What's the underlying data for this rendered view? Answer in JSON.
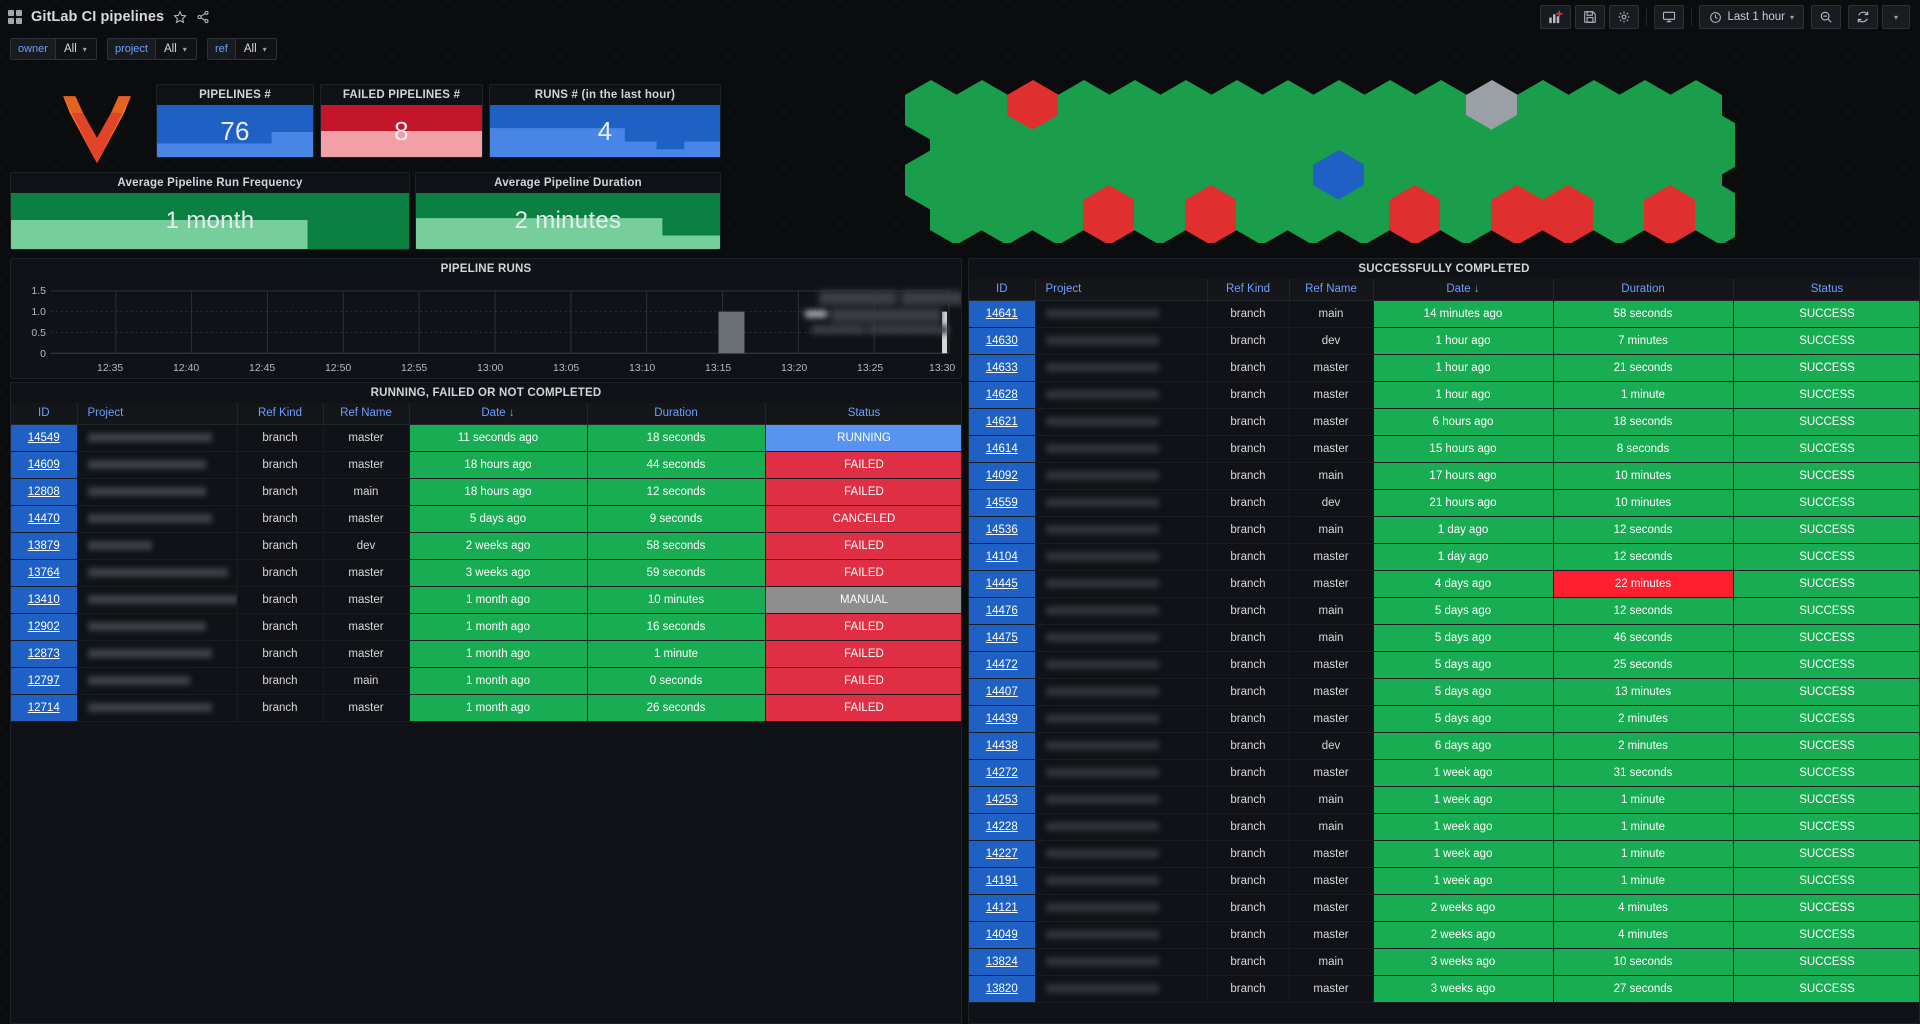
{
  "header": {
    "title": "GitLab CI pipelines",
    "grid_icon": "dashboard-grid-icon",
    "star_icon": "star-icon",
    "share_icon": "share-icon",
    "toolbar": {
      "add_panel_label": "add-panel-icon",
      "save_label": "save-icon",
      "settings_label": "gear-icon",
      "tv_label": "tv-mode-icon",
      "time_range": "Last 1 hour",
      "clock_icon": "clock-icon",
      "zoom_out_icon": "zoom-out-icon",
      "refresh_icon": "refresh-icon",
      "refresh_caret": "chevron-down-icon",
      "time_caret": "chevron-down-icon"
    }
  },
  "variables": [
    {
      "label": "owner",
      "value": "All"
    },
    {
      "label": "project",
      "value": "All"
    },
    {
      "label": "ref",
      "value": "All"
    }
  ],
  "stats": [
    {
      "title": "PIPELINES #",
      "value": "76",
      "color": "#1f60c4"
    },
    {
      "title": "FAILED PIPELINES #",
      "value": "8",
      "color": "#c4162a"
    },
    {
      "title": "RUNS # (in the last hour)",
      "value": "4",
      "color": "#1f60c4"
    },
    {
      "title": "Average Pipeline Run Frequency",
      "value": "1 month",
      "color": "#0a8041"
    },
    {
      "title": "Average Pipeline Duration",
      "value": "2 minutes",
      "color": "#0a8041"
    }
  ],
  "timeseries": {
    "title": "PIPELINE RUNS"
  },
  "chart_data": {
    "type": "bar",
    "title": "PIPELINE RUNS",
    "xlabel": "",
    "ylabel": "",
    "ylim": [
      0,
      1.5
    ],
    "ytick_labels": [
      "1.5",
      "1.0",
      "0.5",
      "0"
    ],
    "yticks": [
      1.5,
      1.0,
      0.5,
      0
    ],
    "x_tick_labels": [
      "12:35",
      "12:40",
      "12:45",
      "12:50",
      "12:55",
      "13:00",
      "13:05",
      "13:10",
      "13:15",
      "13:20",
      "13:25",
      "13:30"
    ],
    "grid": true,
    "legend_position": "right",
    "series": [
      {
        "name": "pipeline runs",
        "x": [
          "12:35",
          "12:40",
          "12:45",
          "12:50",
          "12:55",
          "13:00",
          "13:05",
          "13:10",
          "13:15",
          "13:16",
          "13:20",
          "13:25",
          "13:30"
        ],
        "values": [
          0,
          0,
          0,
          0,
          0,
          0,
          0,
          0,
          1,
          1,
          0,
          0,
          1
        ]
      }
    ]
  },
  "honeycomb": {
    "name": "pipeline-status-honeycomb",
    "rows": [
      [
        "green",
        "green",
        "red",
        "green",
        "green",
        "green",
        "green",
        "green",
        "green",
        "green",
        "green",
        "grey",
        "green",
        "green",
        "green",
        "green"
      ],
      [
        "green",
        "green",
        "green",
        "green",
        "green",
        "green",
        "green",
        "green",
        "green",
        "green",
        "green",
        "green",
        "green",
        "green",
        "green"
      ],
      [
        "green",
        "green",
        "green",
        "green",
        "green",
        "green",
        "green",
        "green",
        "blue",
        "green",
        "green",
        "green",
        "green",
        "green",
        "green",
        "green"
      ],
      [
        "green",
        "green",
        "green",
        "red",
        "green",
        "red",
        "green",
        "green",
        "green",
        "red",
        "green",
        "red",
        "red",
        "green",
        "red",
        "green"
      ]
    ]
  },
  "left_table": {
    "title": "RUNNING, FAILED OR NOT COMPLETED",
    "columns": [
      "ID",
      "Project",
      "Ref Kind",
      "Ref Name",
      "Date ↓",
      "Duration",
      "Status"
    ],
    "rows": [
      {
        "id": "14549",
        "project": "infra/k8s/nginx-ingress",
        "ref_kind": "branch",
        "ref_name": "master",
        "date": "11 seconds ago",
        "duration": "18 seconds",
        "status": "RUNNING",
        "status_color": "blue",
        "date_color": "green",
        "duration_color": "green"
      },
      {
        "id": "14609",
        "project": "infra/terraform/packer",
        "ref_kind": "branch",
        "ref_name": "master",
        "date": "18 hours ago",
        "duration": "44 seconds",
        "status": "FAILED",
        "status_color": "red",
        "date_color": "green",
        "duration_color": "green"
      },
      {
        "id": "12808",
        "project": "infra/terraform/harbor",
        "ref_kind": "branch",
        "ref_name": "main",
        "date": "18 hours ago",
        "duration": "12 seconds",
        "status": "FAILED",
        "status_color": "red",
        "date_color": "green",
        "duration_color": "green"
      },
      {
        "id": "14470",
        "project": "infra/terraform/backend",
        "ref_kind": "branch",
        "ref_name": "master",
        "date": "5 days ago",
        "duration": "9 seconds",
        "status": "CANCELED",
        "status_color": "red",
        "date_color": "green",
        "duration_color": "green"
      },
      {
        "id": "13879",
        "project": "backend/auth",
        "ref_kind": "branch",
        "ref_name": "dev",
        "date": "2 weeks ago",
        "duration": "58 seconds",
        "status": "FAILED",
        "status_color": "red",
        "date_color": "green",
        "duration_color": "green"
      },
      {
        "id": "13764",
        "project": "infra/terraform/cloudflare",
        "ref_kind": "branch",
        "ref_name": "master",
        "date": "3 weeks ago",
        "duration": "59 seconds",
        "status": "FAILED",
        "status_color": "red",
        "date_color": "green",
        "duration_color": "green"
      },
      {
        "id": "13410",
        "project": "data/pipelines/schemas/bq-st…",
        "ref_kind": "branch",
        "ref_name": "master",
        "date": "1 month ago",
        "duration": "10 minutes",
        "status": "MANUAL",
        "status_color": "grey",
        "date_color": "green",
        "duration_color": "green"
      },
      {
        "id": "12902",
        "project": "infra/terraform/gitlab",
        "ref_kind": "branch",
        "ref_name": "master",
        "date": "1 month ago",
        "duration": "16 seconds",
        "status": "FAILED",
        "status_color": "red",
        "date_color": "green",
        "duration_color": "green"
      },
      {
        "id": "12873",
        "project": "infra/terraform/network",
        "ref_kind": "branch",
        "ref_name": "master",
        "date": "1 month ago",
        "duration": "1 minute",
        "status": "FAILED",
        "status_color": "red",
        "date_color": "green",
        "duration_color": "green"
      },
      {
        "id": "12797",
        "project": "infra/terraform/dns",
        "ref_kind": "branch",
        "ref_name": "main",
        "date": "1 month ago",
        "duration": "0 seconds",
        "status": "FAILED",
        "status_color": "red",
        "date_color": "green",
        "duration_color": "green"
      },
      {
        "id": "12714",
        "project": "infra/terraform/grafana",
        "ref_kind": "branch",
        "ref_name": "master",
        "date": "1 month ago",
        "duration": "26 seconds",
        "status": "FAILED",
        "status_color": "red",
        "date_color": "green",
        "duration_color": "green"
      }
    ]
  },
  "right_table": {
    "title": "SUCCESSFULLY COMPLETED",
    "columns": [
      "ID",
      "Project",
      "Ref Kind",
      "Ref Name",
      "Date ↓",
      "Duration",
      "Status"
    ],
    "rows": [
      {
        "id": "14641",
        "ref_kind": "branch",
        "ref_name": "main",
        "date": "14 minutes ago",
        "duration": "58 seconds",
        "status": "SUCCESS",
        "duration_color": "green"
      },
      {
        "id": "14630",
        "ref_kind": "branch",
        "ref_name": "dev",
        "date": "1 hour ago",
        "duration": "7 minutes",
        "status": "SUCCESS",
        "duration_color": "green"
      },
      {
        "id": "14633",
        "ref_kind": "branch",
        "ref_name": "master",
        "date": "1 hour ago",
        "duration": "21 seconds",
        "status": "SUCCESS",
        "duration_color": "green"
      },
      {
        "id": "14628",
        "ref_kind": "branch",
        "ref_name": "master",
        "date": "1 hour ago",
        "duration": "1 minute",
        "status": "SUCCESS",
        "duration_color": "green"
      },
      {
        "id": "14621",
        "ref_kind": "branch",
        "ref_name": "master",
        "date": "6 hours ago",
        "duration": "18 seconds",
        "status": "SUCCESS",
        "duration_color": "green"
      },
      {
        "id": "14614",
        "ref_kind": "branch",
        "ref_name": "master",
        "date": "15 hours ago",
        "duration": "8 seconds",
        "status": "SUCCESS",
        "duration_color": "green"
      },
      {
        "id": "14092",
        "ref_kind": "branch",
        "ref_name": "main",
        "date": "17 hours ago",
        "duration": "10 minutes",
        "status": "SUCCESS",
        "duration_color": "green"
      },
      {
        "id": "14559",
        "ref_kind": "branch",
        "ref_name": "dev",
        "date": "21 hours ago",
        "duration": "10 minutes",
        "status": "SUCCESS",
        "duration_color": "green"
      },
      {
        "id": "14536",
        "ref_kind": "branch",
        "ref_name": "main",
        "date": "1 day ago",
        "duration": "12 seconds",
        "status": "SUCCESS",
        "duration_color": "green"
      },
      {
        "id": "14104",
        "ref_kind": "branch",
        "ref_name": "master",
        "date": "1 day ago",
        "duration": "12 seconds",
        "status": "SUCCESS",
        "duration_color": "green"
      },
      {
        "id": "14445",
        "ref_kind": "branch",
        "ref_name": "master",
        "date": "4 days ago",
        "duration": "22 minutes",
        "status": "SUCCESS",
        "duration_color": "redb"
      },
      {
        "id": "14476",
        "ref_kind": "branch",
        "ref_name": "main",
        "date": "5 days ago",
        "duration": "12 seconds",
        "status": "SUCCESS",
        "duration_color": "green"
      },
      {
        "id": "14475",
        "ref_kind": "branch",
        "ref_name": "main",
        "date": "5 days ago",
        "duration": "46 seconds",
        "status": "SUCCESS",
        "duration_color": "green"
      },
      {
        "id": "14472",
        "ref_kind": "branch",
        "ref_name": "master",
        "date": "5 days ago",
        "duration": "25 seconds",
        "status": "SUCCESS",
        "duration_color": "green"
      },
      {
        "id": "14407",
        "ref_kind": "branch",
        "ref_name": "master",
        "date": "5 days ago",
        "duration": "13 minutes",
        "status": "SUCCESS",
        "duration_color": "green"
      },
      {
        "id": "14439",
        "ref_kind": "branch",
        "ref_name": "master",
        "date": "5 days ago",
        "duration": "2 minutes",
        "status": "SUCCESS",
        "duration_color": "green"
      },
      {
        "id": "14438",
        "ref_kind": "branch",
        "ref_name": "dev",
        "date": "6 days ago",
        "duration": "2 minutes",
        "status": "SUCCESS",
        "duration_color": "green"
      },
      {
        "id": "14272",
        "ref_kind": "branch",
        "ref_name": "master",
        "date": "1 week ago",
        "duration": "31 seconds",
        "status": "SUCCESS",
        "duration_color": "green"
      },
      {
        "id": "14253",
        "ref_kind": "branch",
        "ref_name": "main",
        "date": "1 week ago",
        "duration": "1 minute",
        "status": "SUCCESS",
        "duration_color": "green"
      },
      {
        "id": "14228",
        "ref_kind": "branch",
        "ref_name": "main",
        "date": "1 week ago",
        "duration": "1 minute",
        "status": "SUCCESS",
        "duration_color": "green"
      },
      {
        "id": "14227",
        "ref_kind": "branch",
        "ref_name": "master",
        "date": "1 week ago",
        "duration": "1 minute",
        "status": "SUCCESS",
        "duration_color": "green"
      },
      {
        "id": "14191",
        "ref_kind": "branch",
        "ref_name": "master",
        "date": "1 week ago",
        "duration": "1 minute",
        "status": "SUCCESS",
        "duration_color": "green"
      },
      {
        "id": "14121",
        "ref_kind": "branch",
        "ref_name": "master",
        "date": "2 weeks ago",
        "duration": "4 minutes",
        "status": "SUCCESS",
        "duration_color": "green"
      },
      {
        "id": "14049",
        "ref_kind": "branch",
        "ref_name": "master",
        "date": "2 weeks ago",
        "duration": "4 minutes",
        "status": "SUCCESS",
        "duration_color": "green"
      },
      {
        "id": "13824",
        "ref_kind": "branch",
        "ref_name": "main",
        "date": "3 weeks ago",
        "duration": "10 seconds",
        "status": "SUCCESS",
        "duration_color": "green"
      },
      {
        "id": "13820",
        "ref_kind": "branch",
        "ref_name": "master",
        "date": "3 weeks ago",
        "duration": "27 seconds",
        "status": "SUCCESS",
        "duration_color": "green"
      }
    ]
  },
  "colors": {
    "success": "#18ad52",
    "failed": "#e02f44",
    "running": "#5794f2",
    "manual": "#8e8e8e",
    "blue_accent": "#1f60c4",
    "link": "#6e9fff"
  }
}
